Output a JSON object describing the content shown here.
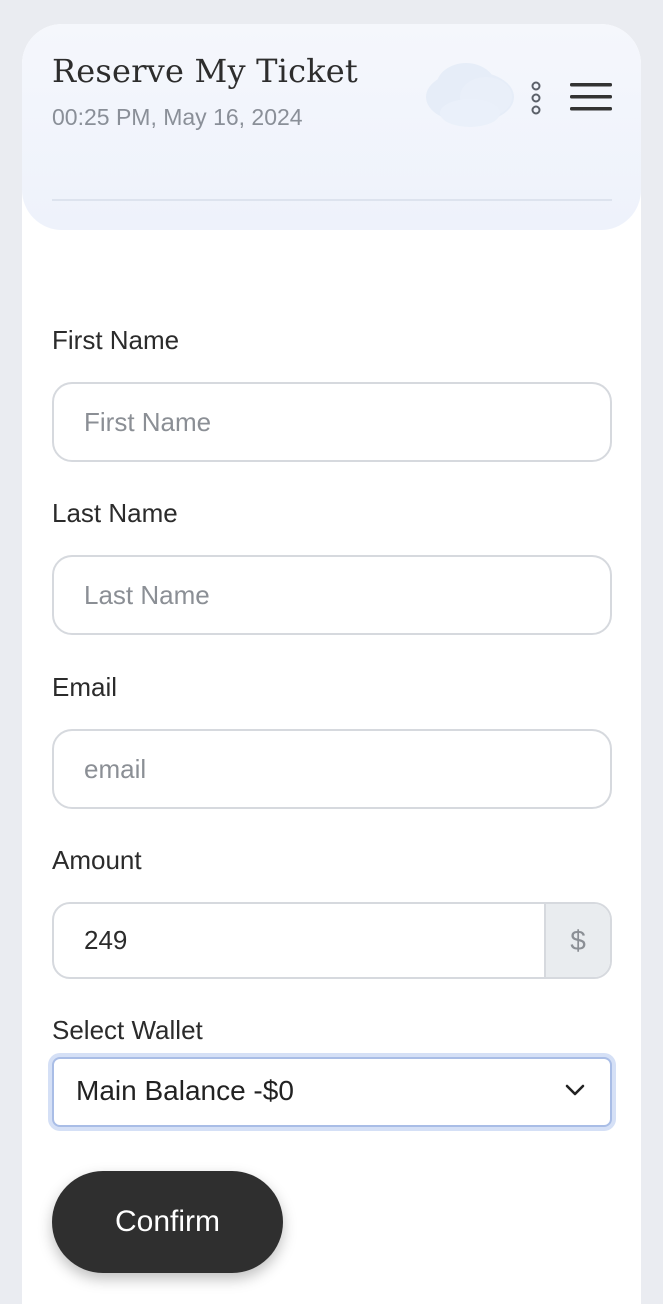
{
  "header": {
    "title": "Reserve My Ticket",
    "datetime": "00:25 PM, May 16, 2024"
  },
  "icons": {
    "weather": "cloud-icon",
    "more": "kebab-menu-icon",
    "menu": "hamburger-menu-icon",
    "dropdown": "chevron-down-icon"
  },
  "form": {
    "first_name": {
      "label": "First Name",
      "placeholder": "First Name",
      "value": ""
    },
    "last_name": {
      "label": "Last Name",
      "placeholder": "Last Name",
      "value": ""
    },
    "email": {
      "label": "Email",
      "placeholder": "email",
      "value": ""
    },
    "amount": {
      "label": "Amount",
      "value": "249",
      "currency": "$"
    },
    "wallet": {
      "label": "Select Wallet",
      "selected": "Main Balance -$0"
    },
    "confirm_label": "Confirm"
  },
  "colors": {
    "background": "#eaecf1",
    "header_bg": "#f1f4fb",
    "button_bg": "#2f2f2f",
    "select_focus": "#a9bde6"
  }
}
